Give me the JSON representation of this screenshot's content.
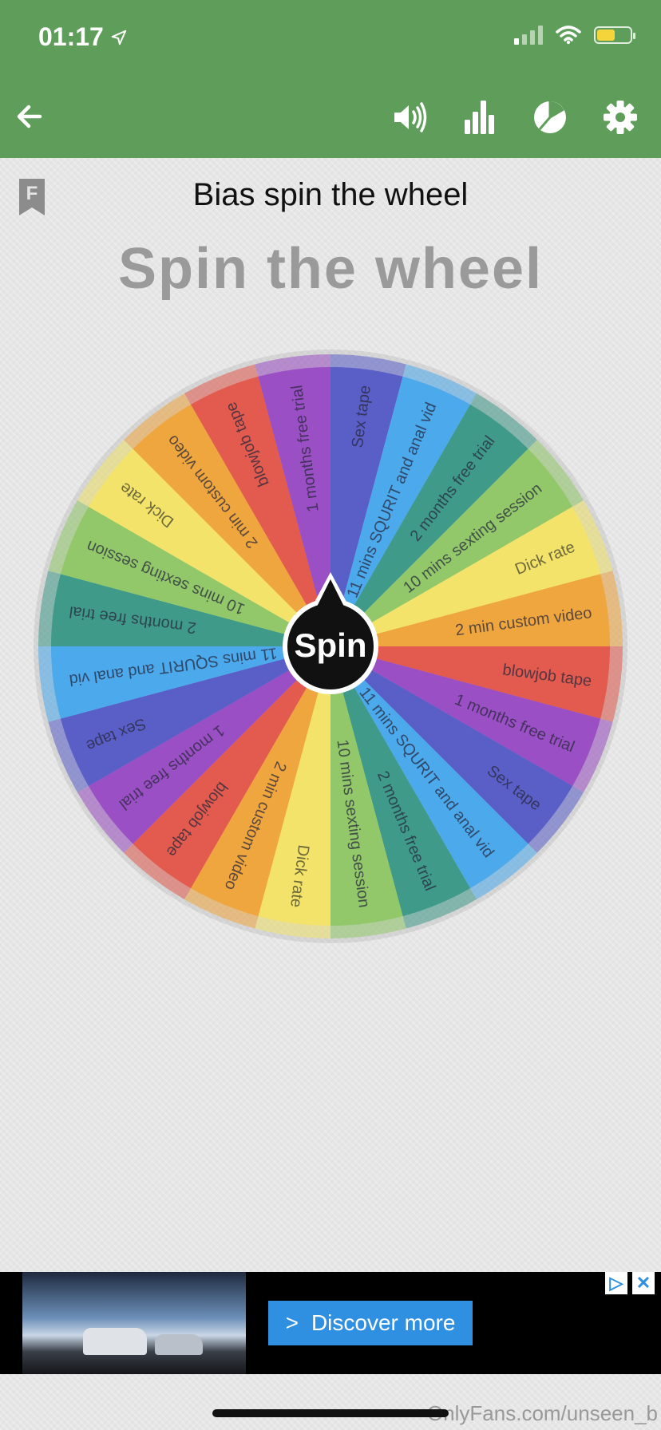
{
  "status_bar": {
    "time": "01:17",
    "location_icon": "location-arrow-icon",
    "wifi_icon": "wifi-icon",
    "battery_color": "#f5d33a"
  },
  "header": {
    "background": "#5f9e5a",
    "back_icon": "back-arrow-icon",
    "actions": [
      "sound-icon",
      "stats-bar-chart-icon",
      "pie-chart-icon",
      "settings-gear-icon"
    ]
  },
  "page": {
    "bookmark_letter": "F",
    "title": "Bias spin the wheel",
    "heading": "Spin the wheel"
  },
  "wheel": {
    "spin_label": "Spin",
    "segments": [
      {
        "label": "Sex tape",
        "color": "#5a5fc8"
      },
      {
        "label": "11 mins SQURIT and anal vid",
        "color": "#4ba9ec"
      },
      {
        "label": "2 months free trial",
        "color": "#3f9a8a"
      },
      {
        "label": "10 mins sexting session",
        "color": "#92c86a"
      },
      {
        "label": "Dick rate",
        "color": "#f3e36a"
      },
      {
        "label": "2 min custom video",
        "color": "#f0a63e"
      },
      {
        "label": "blowjob tape",
        "color": "#e25b4e"
      },
      {
        "label": "1 months free trial",
        "color": "#9a4fc4"
      },
      {
        "label": "Sex tape",
        "color": "#5a5fc8"
      },
      {
        "label": "11 mins SQURIT and anal vid",
        "color": "#4ba9ec"
      },
      {
        "label": "2 months free trial",
        "color": "#3f9a8a"
      },
      {
        "label": "10 mins sexting session",
        "color": "#92c86a"
      },
      {
        "label": "Dick rate",
        "color": "#f3e36a"
      },
      {
        "label": "2 min custom video",
        "color": "#f0a63e"
      },
      {
        "label": "blowjob tape",
        "color": "#e25b4e"
      },
      {
        "label": "1 months free trial",
        "color": "#9a4fc4"
      },
      {
        "label": "Sex tape",
        "color": "#5a5fc8"
      },
      {
        "label": "11 mins SQURIT and anal vid",
        "color": "#4ba9ec"
      },
      {
        "label": "2 months free trial",
        "color": "#3f9a8a"
      },
      {
        "label": "10 mins sexting session",
        "color": "#92c86a"
      },
      {
        "label": "Dick rate",
        "color": "#f3e36a"
      },
      {
        "label": "2 min custom video",
        "color": "#f0a63e"
      },
      {
        "label": "blowjob tape",
        "color": "#e25b4e"
      },
      {
        "label": "1 months free trial",
        "color": "#9a4fc4"
      }
    ]
  },
  "ad": {
    "button_label": "Discover more",
    "adchoices_icon": "ad-choices-icon",
    "close_icon": "close-icon"
  },
  "watermark": "OnlyFans.com/unseen_b"
}
